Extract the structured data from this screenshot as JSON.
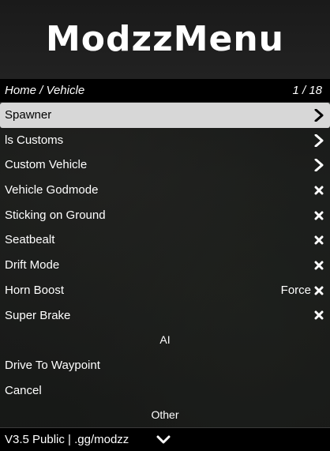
{
  "header": {
    "logo_text": "ModzzMenu"
  },
  "titlebar": {
    "path": "Home / Vehicle",
    "count": "1 / 18"
  },
  "items": [
    {
      "label": "Spawner",
      "type": "submenu",
      "selected": true,
      "icon": "chevron-right-icon"
    },
    {
      "label": "ls Customs",
      "type": "submenu",
      "icon": "chevron-right-icon"
    },
    {
      "label": "Custom Vehicle",
      "type": "submenu",
      "icon": "chevron-right-icon"
    },
    {
      "label": "Vehicle Godmode",
      "type": "toggle",
      "state": "off",
      "icon": "cross-icon"
    },
    {
      "label": "Sticking on Ground",
      "type": "toggle",
      "state": "off",
      "icon": "cross-icon"
    },
    {
      "label": "Seatbealt",
      "type": "toggle",
      "state": "off",
      "icon": "cross-icon"
    },
    {
      "label": "Drift Mode",
      "type": "toggle",
      "state": "off",
      "icon": "cross-icon"
    },
    {
      "label": "Horn Boost",
      "type": "toggle-option",
      "value": "Force",
      "state": "off",
      "icon": "cross-icon"
    },
    {
      "label": "Super Brake",
      "type": "toggle",
      "state": "off",
      "icon": "cross-icon"
    }
  ],
  "sections": {
    "ai": "AI",
    "other": "Other"
  },
  "ai_items": [
    {
      "label": "Drive To Waypoint"
    },
    {
      "label": "Cancel"
    }
  ],
  "footer": {
    "version": "V3.5 Public | .gg/modzz",
    "icon": "chevron-down-icon"
  },
  "colors": {
    "selected_bg": "#d7d7d7",
    "bar_bg": "#000000",
    "text": "#ffffff"
  }
}
